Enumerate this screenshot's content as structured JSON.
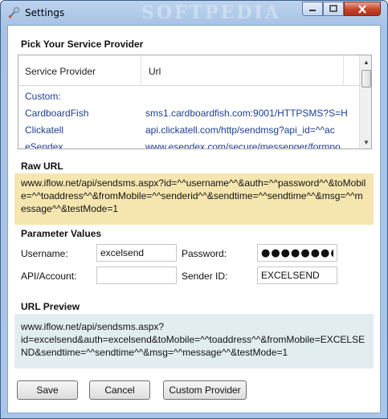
{
  "window": {
    "title": "Settings",
    "watermark": "SOFTPEDIA"
  },
  "provider": {
    "section_title": "Pick Your Service Provider",
    "columns": [
      "Service Provider",
      "Url"
    ],
    "rows": [
      {
        "name": "Custom:",
        "url": ""
      },
      {
        "name": "CardboardFish",
        "url": "sms1.cardboardfish.com:9001/HTTPSMS?S=H"
      },
      {
        "name": "Clickatell",
        "url": "api.clickatell.com/http/sendmsg?api_id=^^ac"
      },
      {
        "name": "eSendex",
        "url": "www.esendex.com/secure/messenger/formpo"
      }
    ]
  },
  "raw_url": {
    "section_title": "Raw URL",
    "value": "www.iflow.net/api/sendsms.aspx?id=^^username^^&auth=^^password^^&toMobile=^^toaddress^^&fromMobile=^^senderid^^&sendtime=^^sendtime^^&msg=^^message^^&testMode=1"
  },
  "params": {
    "section_title": "Parameter Values",
    "username_label": "Username:",
    "username_value": "excelsend",
    "password_label": "Password:",
    "password_value": "●●●●●●●●●",
    "api_label": "API/Account:",
    "api_value": "",
    "sender_label": "Sender ID:",
    "sender_value": "EXCELSEND"
  },
  "preview": {
    "section_title": "URL Preview",
    "value": "www.iflow.net/api/sendsms.aspx?\nid=excelsend&auth=excelsend&toMobile=^^toaddress^^&fromMobile=EXCELSEND&sendtime=^^sendtime^^&msg=^^message^^&testMode=1"
  },
  "buttons": {
    "save": "Save",
    "cancel": "Cancel",
    "custom": "Custom Provider"
  }
}
